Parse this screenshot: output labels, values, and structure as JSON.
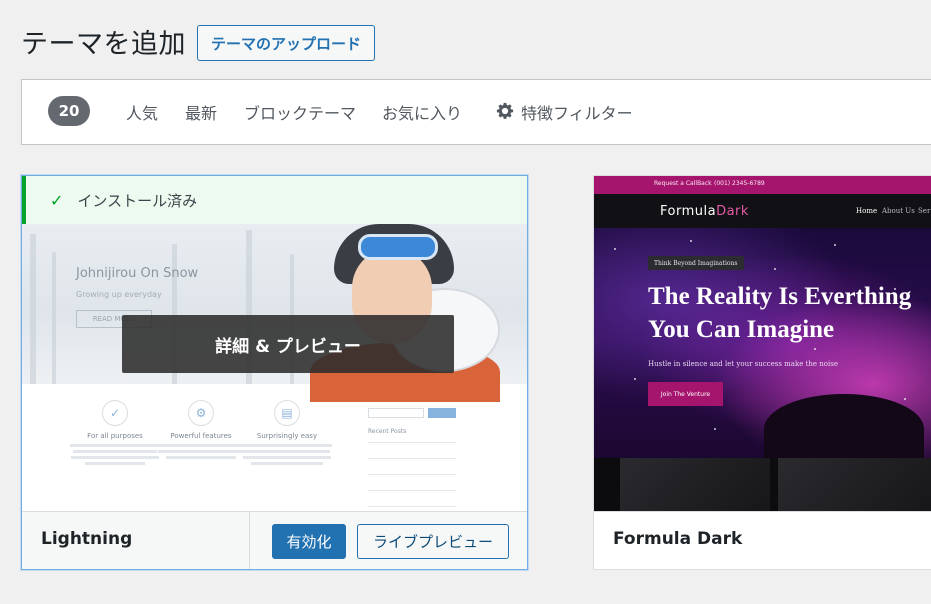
{
  "header": {
    "title": "テーマを追加",
    "upload_button": "テーマのアップロード"
  },
  "filter_bar": {
    "count": "20",
    "links": [
      "人気",
      "最新",
      "ブロックテーマ",
      "お気に入り"
    ],
    "feature_filter": "特徴フィルター",
    "feature_filter_icon": "gear-icon"
  },
  "themes": [
    {
      "name": "Lightning",
      "installed_label": "インストール済み",
      "details_overlay": "詳細 & プレビュー",
      "activate_label": "有効化",
      "live_preview_label": "ライブプレビュー",
      "screenshot": {
        "site_title": "Johnijirou On Snow",
        "tagline": "Growing up everyday",
        "read_more": "READ MORE",
        "features": [
          "For all purposes",
          "Powerful features",
          "Surprisingly easy"
        ],
        "search_button": "Search",
        "recent_posts": "Recent Posts"
      }
    },
    {
      "name": "Formula Dark",
      "screenshot": {
        "top_left": "Request a CallBack",
        "phone": "(001) 2345-6789",
        "logo_main": "Formula",
        "logo_accent": "Dark",
        "menu": [
          "Home",
          "About Us",
          "Ser"
        ],
        "tag": "Think Beyond Imaginations",
        "headline": "The Reality Is Everthing You Can Imagine",
        "sub": "Hustle in silence and let your success make the noise",
        "cta": "Join The Venture"
      }
    }
  ],
  "colors": {
    "primary": "#2271b1",
    "installed_green": "#00a32a",
    "formula_accent": "#a5156d"
  }
}
